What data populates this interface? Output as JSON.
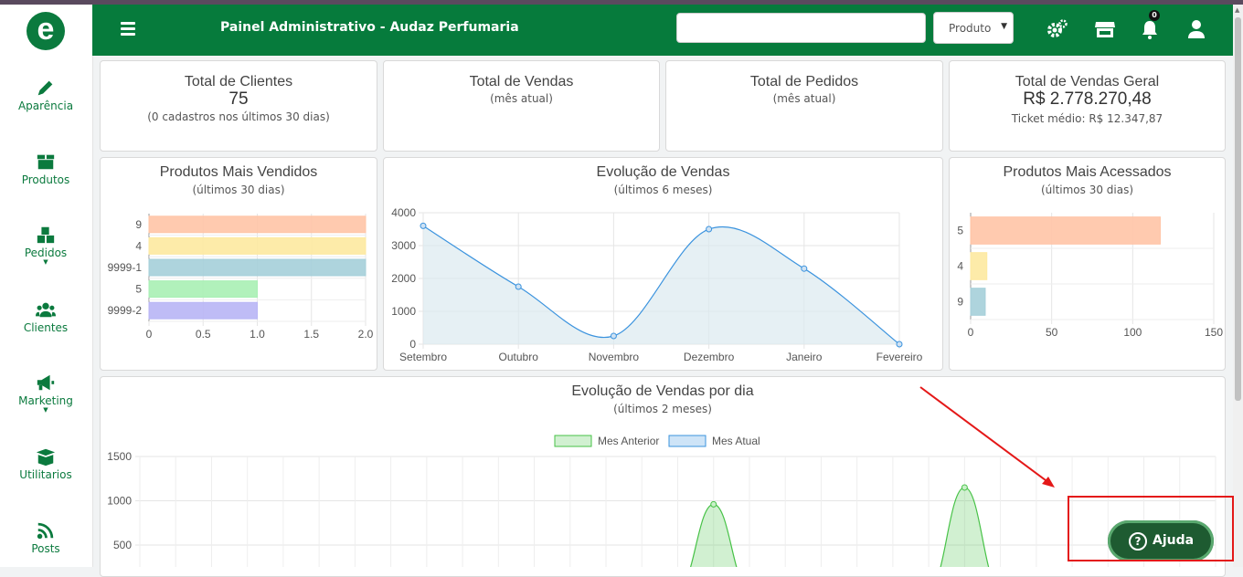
{
  "brand": {
    "logo_letter": "e",
    "color": "#067b3c"
  },
  "sidebar": {
    "items": [
      {
        "label": "Aparência",
        "icon": "pencil-icon"
      },
      {
        "label": "Produtos",
        "icon": "box-icon"
      },
      {
        "label": "Pedidos",
        "icon": "boxes-icon"
      },
      {
        "label": "Clientes",
        "icon": "users-icon"
      },
      {
        "label": "Marketing",
        "icon": "megaphone-icon"
      },
      {
        "label": "Utilitarios",
        "icon": "gift-box-icon"
      },
      {
        "label": "Posts",
        "icon": "rss-icon"
      }
    ]
  },
  "header": {
    "title": "Painel Administrativo - Audaz Perfumaria",
    "search_value": "",
    "select_value": "Produto",
    "notifications_count": "0"
  },
  "cards": {
    "clientes": {
      "title": "Total de Clientes",
      "value": "75",
      "sub": "(0 cadastros nos últimos 30 dias)"
    },
    "vendas": {
      "title": "Total de Vendas",
      "sub": "(mês atual)"
    },
    "pedidos": {
      "title": "Total de Pedidos",
      "sub": "(mês atual)"
    },
    "geral": {
      "title": "Total de Vendas Geral",
      "value": "R$ 2.778.270,48",
      "sub": "Ticket médio: R$ 12.347,87"
    }
  },
  "chart_data": [
    {
      "type": "bar",
      "orientation": "horizontal",
      "title": "Produtos Mais Vendidos",
      "subtitle": "(últimos 30 dias)",
      "categories": [
        "9",
        "4",
        "9999-1",
        "5",
        "9999-2"
      ],
      "values": [
        2,
        2,
        2,
        1,
        1
      ],
      "colors": [
        "#ffc4a6",
        "#fde9a0",
        "#a5cfd9",
        "#a8efb4",
        "#b8b5f5"
      ],
      "xlim": [
        0,
        2
      ],
      "ticks": [
        "0",
        "0.5",
        "1.0",
        "1.5",
        "2.0"
      ]
    },
    {
      "type": "area",
      "title": "Evolução de Vendas",
      "subtitle": "(últimos 6 meses)",
      "categories": [
        "Setembro",
        "Outubro",
        "Novembro",
        "Dezembro",
        "Janeiro",
        "Fevereiro"
      ],
      "values": [
        3600,
        1750,
        250,
        3500,
        2300,
        0
      ],
      "ylim": [
        0,
        4000
      ],
      "ticks": [
        "0",
        "1000",
        "2000",
        "3000",
        "4000"
      ],
      "color": "#3b93de"
    },
    {
      "type": "bar",
      "orientation": "horizontal",
      "title": "Produtos Mais Acessados",
      "subtitle": "(últimos 30 dias)",
      "categories": [
        "5",
        "4",
        "9"
      ],
      "values": [
        117,
        10,
        9
      ],
      "colors": [
        "#ffc4a6",
        "#fde9a0",
        "#a5cfd9"
      ],
      "xlim": [
        0,
        150
      ],
      "ticks": [
        "0",
        "50",
        "100",
        "150"
      ]
    },
    {
      "type": "area",
      "title": "Evolução de Vendas por dia",
      "subtitle": "(últimos 2 meses)",
      "legend": [
        "Mes Anterior",
        "Mes Atual"
      ],
      "legend_colors": [
        "#47c247",
        "#3b93de"
      ],
      "ylim": [
        0,
        1500
      ],
      "ticks": [
        "500",
        "1000",
        "1500"
      ],
      "peaks": [
        {
          "series": "Mes Anterior",
          "day": 16,
          "value": 960
        },
        {
          "series": "Mes Anterior",
          "day": 23,
          "value": 1150
        }
      ],
      "days": 31
    }
  ],
  "help": {
    "label": "Ajuda"
  },
  "annotation": {
    "color": "#e41818"
  }
}
